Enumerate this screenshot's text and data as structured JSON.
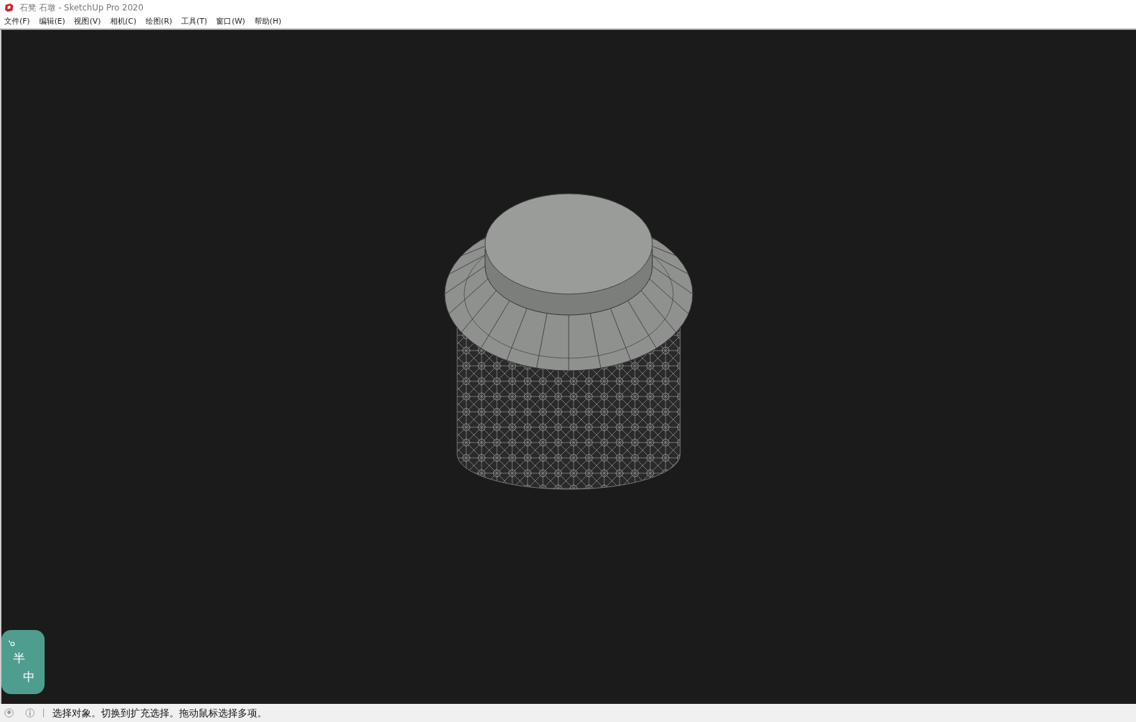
{
  "window": {
    "title": "石凳 石墩 - SketchUp Pro 2020"
  },
  "menu": [
    "文件(F)",
    "编辑(E)",
    "视图(V)",
    "相机(C)",
    "绘图(R)",
    "工具(T)",
    "窗口(W)",
    "帮助(H)"
  ],
  "ime_widget": {
    "width_mode": "半",
    "language": "中"
  },
  "status_bar": {
    "message": "选择对象。切换到扩充选择。拖动鼠标选择多项。"
  }
}
